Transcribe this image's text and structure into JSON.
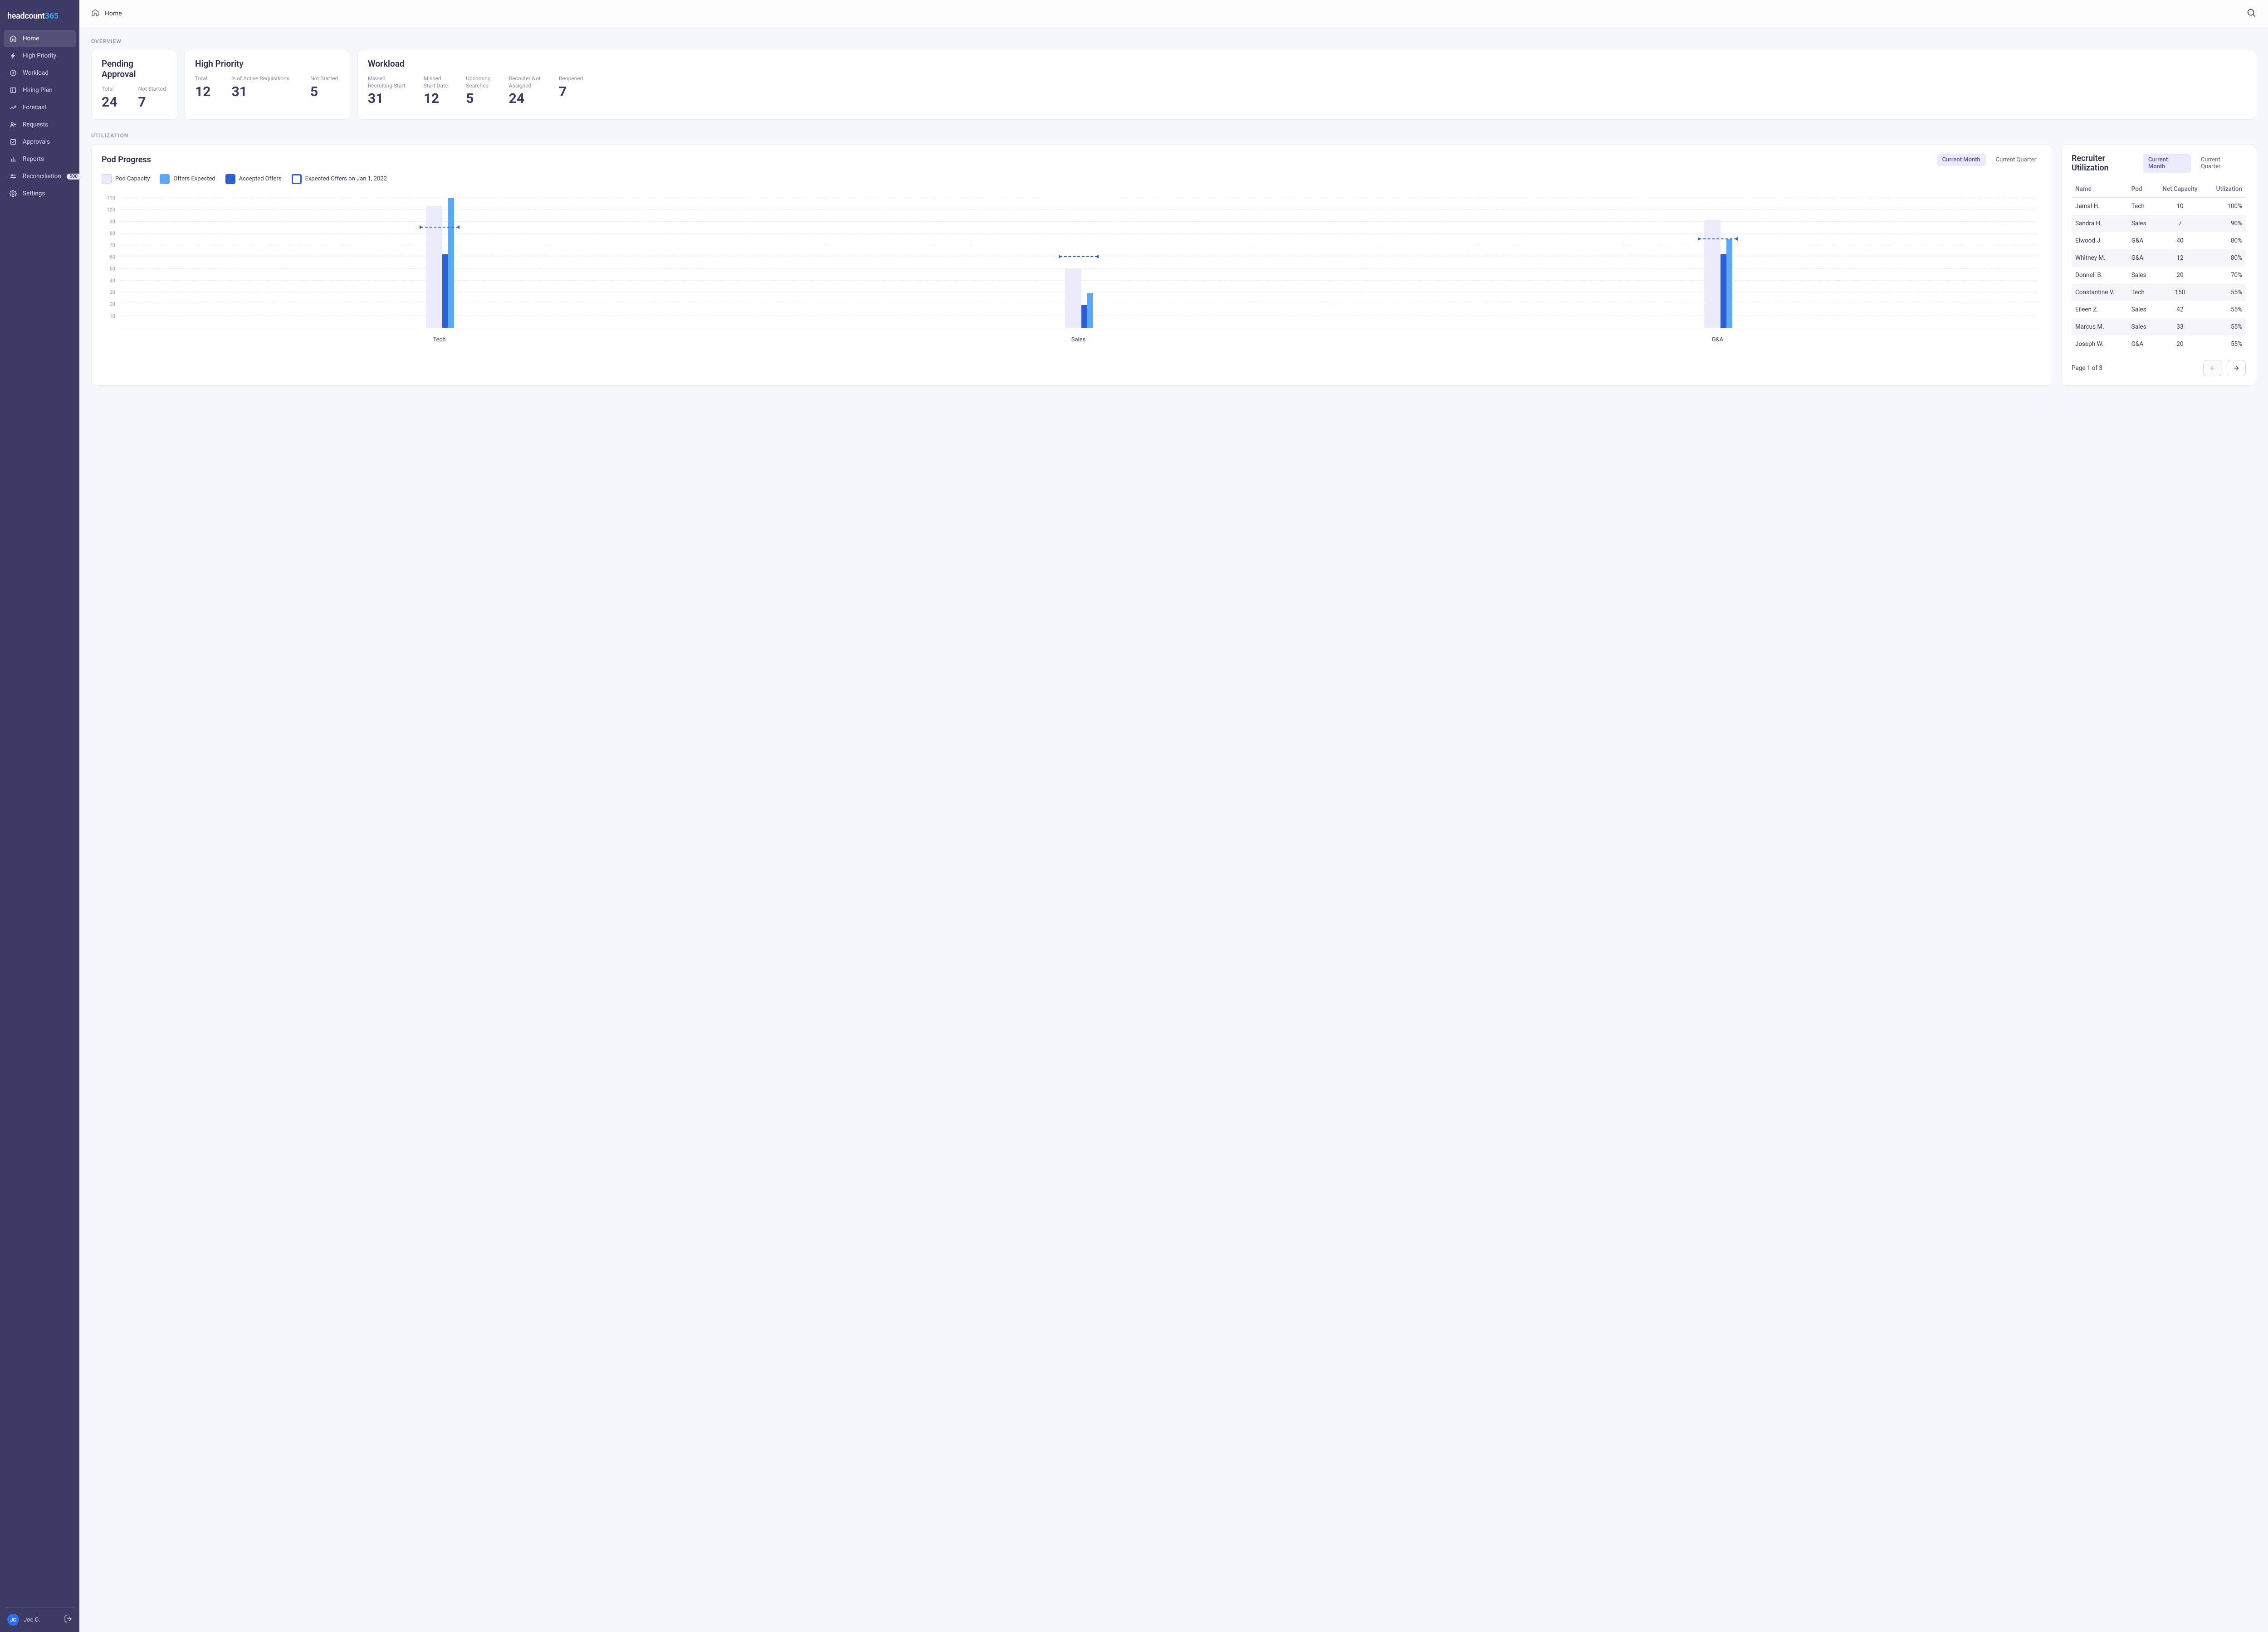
{
  "brand": {
    "name": "headcount",
    "suffix": "365"
  },
  "sidebar": {
    "items": [
      {
        "label": "Home",
        "icon": "home",
        "active": true
      },
      {
        "label": "High Priority",
        "icon": "bolt"
      },
      {
        "label": "Workload",
        "icon": "gauge"
      },
      {
        "label": "Hiring Plan",
        "icon": "book"
      },
      {
        "label": "Forecast",
        "icon": "trend"
      },
      {
        "label": "Requests",
        "icon": "person-plus"
      },
      {
        "label": "Approvals",
        "icon": "check-list"
      },
      {
        "label": "Reports",
        "icon": "bar-chart"
      },
      {
        "label": "Reconciliation",
        "icon": "sliders",
        "badge": "500"
      },
      {
        "label": "Settings",
        "icon": "gear"
      }
    ]
  },
  "user": {
    "initials": "JC",
    "name": "Joe C."
  },
  "breadcrumb": "Home",
  "overview": {
    "section_label": "OVERVIEW",
    "pending": {
      "title": "Pending Approval",
      "metrics": [
        {
          "label": "Total",
          "value": "24"
        },
        {
          "label": "Not Started",
          "value": "7"
        }
      ]
    },
    "high_priority": {
      "title": "High Priority",
      "metrics": [
        {
          "label": "Total",
          "value": "12"
        },
        {
          "label": "% of Active Requisitions",
          "value": "31"
        },
        {
          "label": "Not Started",
          "value": "5"
        }
      ]
    },
    "workload": {
      "title": "Workload",
      "metrics": [
        {
          "label": "Missed\nRecruiting Start",
          "value": "31"
        },
        {
          "label": "Missed\nStart Date",
          "value": "12"
        },
        {
          "label": "Upcoming\nSearches",
          "value": "5"
        },
        {
          "label": "Recruiter Not\nAssigned",
          "value": "24"
        },
        {
          "label": "Reopened",
          "value": "7"
        }
      ]
    }
  },
  "utilization": {
    "section_label": "UTILIZATION",
    "pod_progress": {
      "title": "Pod Progress",
      "toggle": {
        "current_month": "Current Month",
        "current_quarter": "Current Quarter",
        "active": "month"
      },
      "legend": {
        "capacity": "Pod Capacity",
        "offers_expected": "Offers Expected",
        "accepted": "Accepted Offers",
        "target": "Expected Offers on Jan 1, 2022"
      }
    },
    "recruiter": {
      "title": "Recruiter Utilization",
      "toggle": {
        "current_month": "Current Month",
        "current_quarter": "Current Quarter",
        "active": "month"
      },
      "columns": {
        "name": "Name",
        "pod": "Pod",
        "net_capacity": "Net Capacity",
        "utilization": "Utlization"
      },
      "rows": [
        {
          "name": "Jamal H.",
          "pod": "Tech",
          "net_capacity": "10",
          "utilization": "100%"
        },
        {
          "name": "Sandra H.",
          "pod": "Sales",
          "net_capacity": "7",
          "utilization": "90%"
        },
        {
          "name": "Elwood J.",
          "pod": "G&A",
          "net_capacity": "40",
          "utilization": "80%"
        },
        {
          "name": "Whitney M.",
          "pod": "G&A",
          "net_capacity": "12",
          "utilization": "80%"
        },
        {
          "name": "Donnell B.",
          "pod": "Sales",
          "net_capacity": "20",
          "utilization": "70%"
        },
        {
          "name": "Constantine V.",
          "pod": "Tech",
          "net_capacity": "150",
          "utilization": "55%"
        },
        {
          "name": "Eileen Z.",
          "pod": "Sales",
          "net_capacity": "42",
          "utilization": "55%"
        },
        {
          "name": "Marcus M.",
          "pod": "Sales",
          "net_capacity": "33",
          "utilization": "55%"
        },
        {
          "name": "Joseph W.",
          "pod": "G&A",
          "net_capacity": "20",
          "utilization": "55%"
        }
      ],
      "page_info": "Page 1 of 3"
    }
  },
  "chart_data": {
    "type": "bar",
    "title": "Pod Progress",
    "categories": [
      "Tech",
      "Sales",
      "G&A"
    ],
    "y_ticks": [
      10,
      20,
      30,
      40,
      50,
      60,
      70,
      80,
      90,
      100,
      110
    ],
    "ylim": [
      0,
      115
    ],
    "series": [
      {
        "name": "Pod Capacity",
        "color": "#ecebfb",
        "values": [
          103,
          50,
          91
        ]
      },
      {
        "name": "Accepted Offers",
        "color": "#2d5fd1",
        "values": [
          62,
          19,
          62
        ]
      },
      {
        "name": "Offers Expected",
        "color": "#5aa9f2",
        "values": [
          110,
          29,
          75
        ]
      },
      {
        "name": "Expected Offers on Jan 1, 2022",
        "color": "#2d5fd1",
        "style": "target-line",
        "values": [
          85,
          60,
          75
        ]
      }
    ]
  },
  "colors": {
    "sidebar_bg": "#3b3b66",
    "accent_blue": "#3ea6ea",
    "primary_purple": "#5a4fcf",
    "bar_dark": "#2d5fd1",
    "bar_light": "#5aa9f2",
    "bar_bg": "#ecebfb"
  }
}
